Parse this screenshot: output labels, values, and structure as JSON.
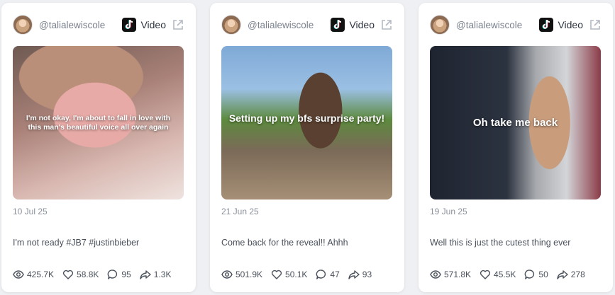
{
  "posts": [
    {
      "handle": "@talialewiscole",
      "platform": "Video",
      "platform_icon": "tiktok-icon",
      "thumbnail_caption": "I'm not okay, I'm about to fall in love with this man's beautiful voice all over again",
      "date": "10 Jul 25",
      "description": "I'm not ready #JB7 #justinbieber",
      "views": "425.7K",
      "likes": "58.8K",
      "comments": "95",
      "shares": "1.3K"
    },
    {
      "handle": "@talialewiscole",
      "platform": "Video",
      "platform_icon": "tiktok-icon",
      "thumbnail_caption": "Setting up my bfs surprise party!",
      "date": "21 Jun 25",
      "description": "Come back for the reveal!! Ahhh",
      "views": "501.9K",
      "likes": "50.1K",
      "comments": "47",
      "shares": "93"
    },
    {
      "handle": "@talialewiscole",
      "platform": "Video",
      "platform_icon": "tiktok-icon",
      "thumbnail_caption": "Oh take me back",
      "date": "19 Jun 25",
      "description": "Well this is just the cutest thing ever",
      "views": "571.8K",
      "likes": "45.5K",
      "comments": "50",
      "shares": "278"
    }
  ],
  "colors": {
    "background": "#eef0f3",
    "card": "#ffffff",
    "text_muted": "#8a909b",
    "text": "#4a505b"
  }
}
